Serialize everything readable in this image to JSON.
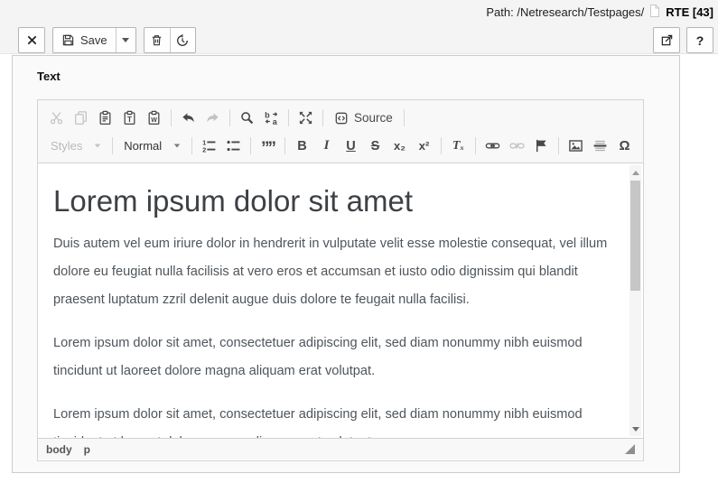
{
  "docheader": {
    "path": "Path: /Netresearch/Testpages/",
    "record_title": "RTE [43]",
    "save_label": "Save",
    "help_label": "?"
  },
  "form": {
    "field_label": "Text"
  },
  "editor": {
    "toolbar": {
      "source_label": "Source",
      "styles_label": "Styles",
      "format_label": "Normal",
      "bold_label": "B",
      "italic_label": "I",
      "underline_label": "U",
      "strike_label": "S",
      "subscript_label": "x₂",
      "superscript_label": "x²",
      "removeformat_label": "Tₓ",
      "blockquote_label": "””",
      "specialchar_label": "Ω"
    },
    "content": {
      "heading": "Lorem ipsum dolor sit amet",
      "paragraphs": [
        "Duis autem vel eum iriure dolor in hendrerit in vulputate velit esse molestie consequat, vel illum dolore eu feugiat nulla facilisis at vero eros et accumsan et iusto odio dignissim qui blandit praesent luptatum zzril delenit augue duis dolore te feugait nulla facilisi.",
        "Lorem ipsum dolor sit amet, consectetuer adipiscing elit, sed diam nonummy nibh euismod tincidunt ut laoreet dolore magna aliquam erat volutpat.",
        "Lorem ipsum dolor sit amet, consectetuer adipiscing elit, sed diam nonummy nibh euismod tincidunt ut laoreet dolore magna aliquam erat volutpat."
      ]
    },
    "elements_path": [
      "body",
      "p"
    ]
  },
  "colors": {
    "docheader_bg": "#f4f4f4",
    "panel_bg": "#fafafa",
    "toolbar_bg": "#f8f8f8",
    "icon": "#484848",
    "icon_disabled": "#c3c3c3",
    "body_text": "#4e555b"
  }
}
